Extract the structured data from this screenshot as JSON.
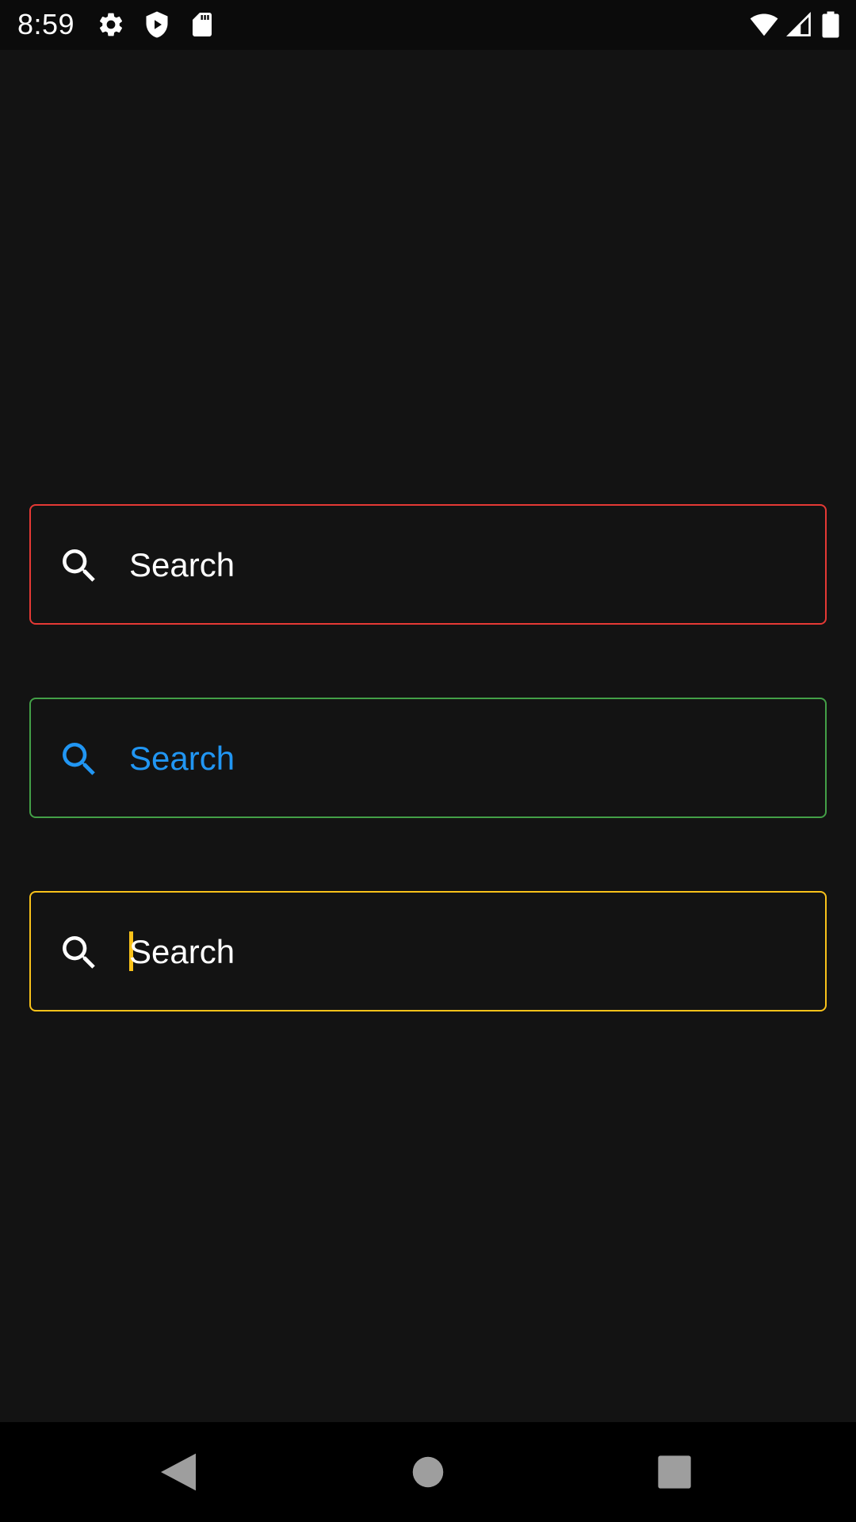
{
  "status_bar": {
    "time": "8:59",
    "icons": [
      "gear-icon",
      "play-protect-icon",
      "sd-card-icon",
      "wifi-icon",
      "cell-signal-icon",
      "battery-icon"
    ]
  },
  "fields": [
    {
      "placeholder": "Search",
      "border_color": "#e53935",
      "text_color": "#ffffff",
      "icon": "search-icon",
      "state": "error"
    },
    {
      "placeholder": "Search",
      "border_color": "#43a047",
      "text_color": "#2196f3",
      "icon": "search-icon",
      "state": "success"
    },
    {
      "placeholder": "Search",
      "border_color": "#f9c21a",
      "text_color": "#ffffff",
      "icon": "search-icon",
      "state": "focused",
      "caret_color": "#f9c21a"
    }
  ],
  "nav_bar": {
    "buttons": [
      "back-icon",
      "home-icon",
      "recents-icon"
    ]
  },
  "colors": {
    "background": "#131313",
    "status_bar": "#0b0b0b",
    "nav_bar": "#000000"
  }
}
